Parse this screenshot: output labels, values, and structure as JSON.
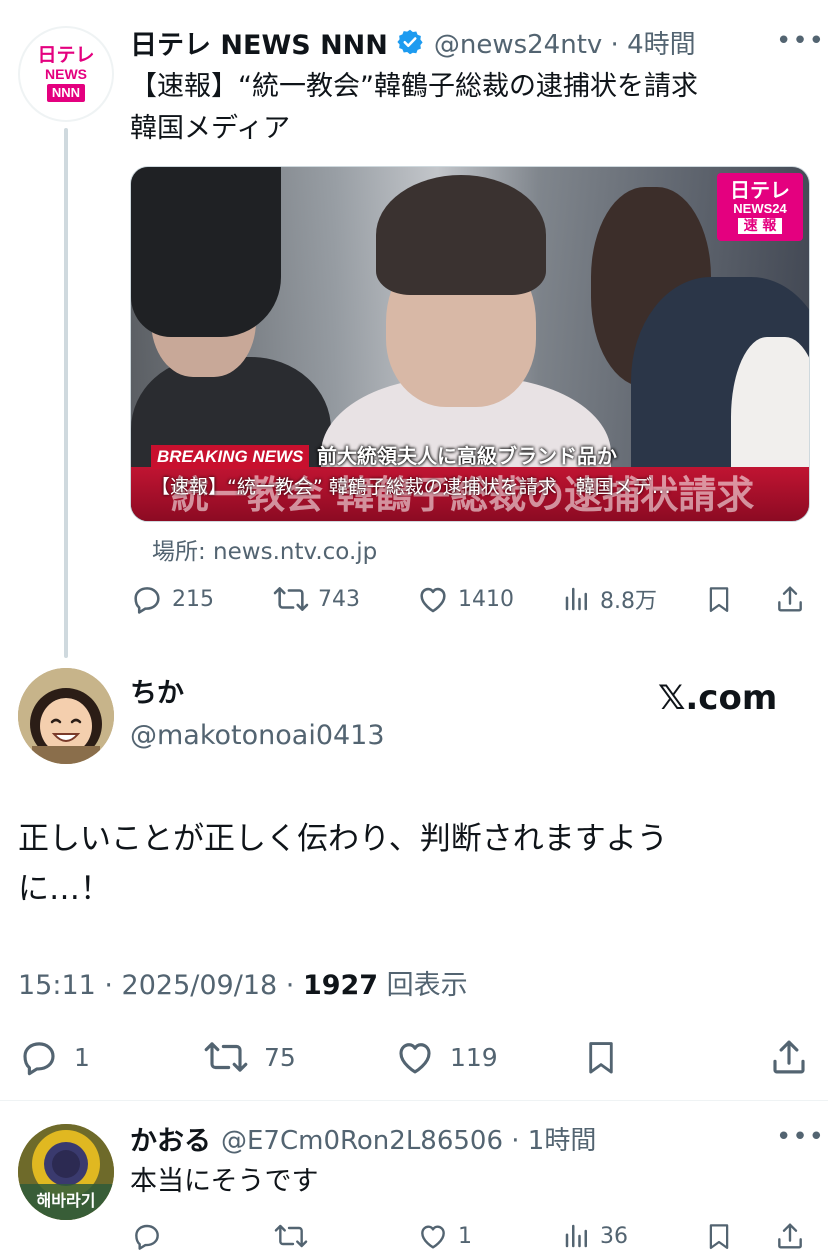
{
  "colors": {
    "text": "#0f1419",
    "muted": "#536471",
    "verified": "#1d9bf0",
    "ntv_pink": "#e4007f",
    "breaking_red": "#c8102e"
  },
  "quoted_tweet": {
    "avatar_line1": "日テレ",
    "avatar_line2": "NEWS",
    "avatar_line3": "NNN",
    "name": "日テレ NEWS NNN",
    "handle_time": "@news24ntv · 4時間",
    "text_line1": "【速報】“統一教会”韓鶴子総裁の逮捕状を請求",
    "text_line2": "韓国メディア",
    "media": {
      "logo_line1": "日テレ",
      "logo_line2": "NEWS24",
      "logo_line3": "速 報",
      "breaking_label": "BREAKING NEWS",
      "breaking_sub": "前大統領夫人に高級ブランド品か",
      "ticker_big": "統一教会 韓鶴子総裁の逮捕状請求",
      "ticker_small": "【速報】“統一教会” 韓鶴子総裁の逮捕状を請求　韓国メデ…"
    },
    "source": "場所: news.ntv.co.jp",
    "actions": {
      "replies": "215",
      "reposts": "743",
      "likes": "1410",
      "views": "8.8万"
    }
  },
  "main_tweet": {
    "name": "ちか",
    "handle": "@makotonoai0413",
    "brand": "𝕏.com",
    "text_line1": "正しいことが正しく伝わり、判断されますよう",
    "text_line2": "に…！",
    "time_date": "15:11 · 2025/09/18 · ",
    "view_count": "1927",
    "view_label": " 回表示",
    "actions": {
      "replies": "1",
      "reposts": "75",
      "likes": "119"
    }
  },
  "reply_tweet": {
    "name": "かおる",
    "handle_time": "@E7Cm0Ron2L86506 · 1時間",
    "text": "本当にそうです",
    "avatar_text": "해바라기",
    "actions": {
      "replies": "",
      "reposts": "",
      "likes": "1",
      "views": "36"
    }
  },
  "icons": [
    "more-icon",
    "verified-icon",
    "reply-icon",
    "repost-icon",
    "like-icon",
    "views-icon",
    "bookmark-icon",
    "share-icon"
  ]
}
